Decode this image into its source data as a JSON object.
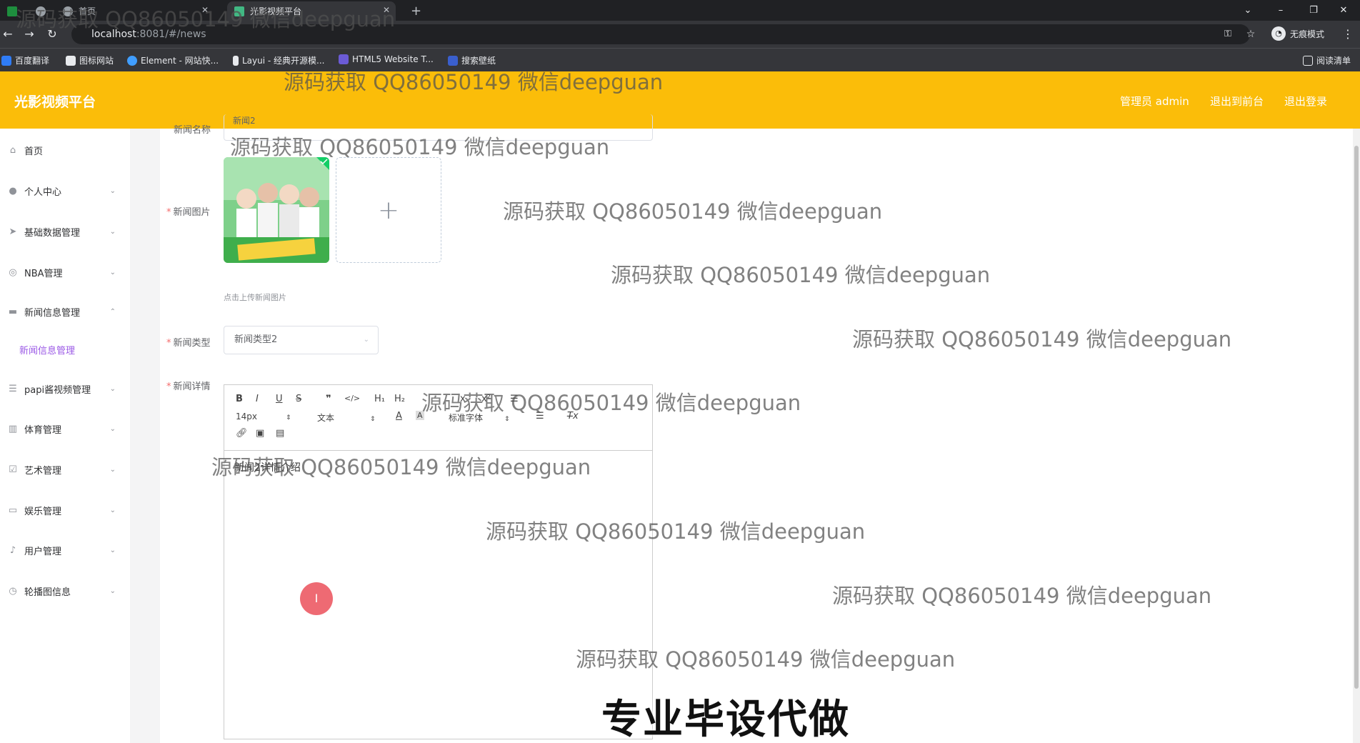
{
  "browser": {
    "tabs": [
      {
        "label": "首页"
      },
      {
        "label": "光影视频平台"
      }
    ],
    "url_host": "localhost",
    "url_path": ":8081/#/news",
    "incognito_label": "无痕模式",
    "bookmarks": [
      "百度翻译",
      "图标网站",
      "Element - 网站快...",
      "Layui - 经典开源模...",
      "HTML5 Website T...",
      "搜索壁纸"
    ],
    "reading_list": "阅读清单"
  },
  "header": {
    "brand": "光影视频平台",
    "user": "管理员 admin",
    "to_front": "退出到前台",
    "logout": "退出登录"
  },
  "sidebar": {
    "items": [
      {
        "label": "首页",
        "icon": "home-icon"
      },
      {
        "label": "个人中心",
        "icon": "user-icon"
      },
      {
        "label": "基础数据管理",
        "icon": "send-icon"
      },
      {
        "label": "NBA管理",
        "icon": "basketball-icon"
      },
      {
        "label": "新闻信息管理",
        "icon": "message-icon"
      },
      {
        "label": "papi酱视频管理",
        "icon": "list-icon"
      },
      {
        "label": "体育管理",
        "icon": "chart-icon"
      },
      {
        "label": "艺术管理",
        "icon": "check-icon"
      },
      {
        "label": "娱乐管理",
        "icon": "chat-icon"
      },
      {
        "label": "用户管理",
        "icon": "mic-icon"
      },
      {
        "label": "轮播图信息",
        "icon": "clock-icon"
      }
    ],
    "sub_active": "新闻信息管理"
  },
  "form": {
    "name_label": "新闻名称",
    "name_value": "新闻2",
    "image_label": "新闻图片",
    "upload_tip": "点击上传新闻图片",
    "type_label": "新闻类型",
    "type_value": "新闻类型2",
    "detail_label": "新闻详情",
    "editor": {
      "font_size": "14px",
      "paragraph": "文本",
      "font_family": "标准字体",
      "content": "新闻2详情介绍"
    }
  },
  "watermark": "源码获取 QQ86050149 微信deepguan",
  "overlay_caption": "专业毕设代做",
  "colors": {
    "header": "#fbbd09",
    "submenu_active": "#9b59e6",
    "required": "#f56c6c"
  }
}
